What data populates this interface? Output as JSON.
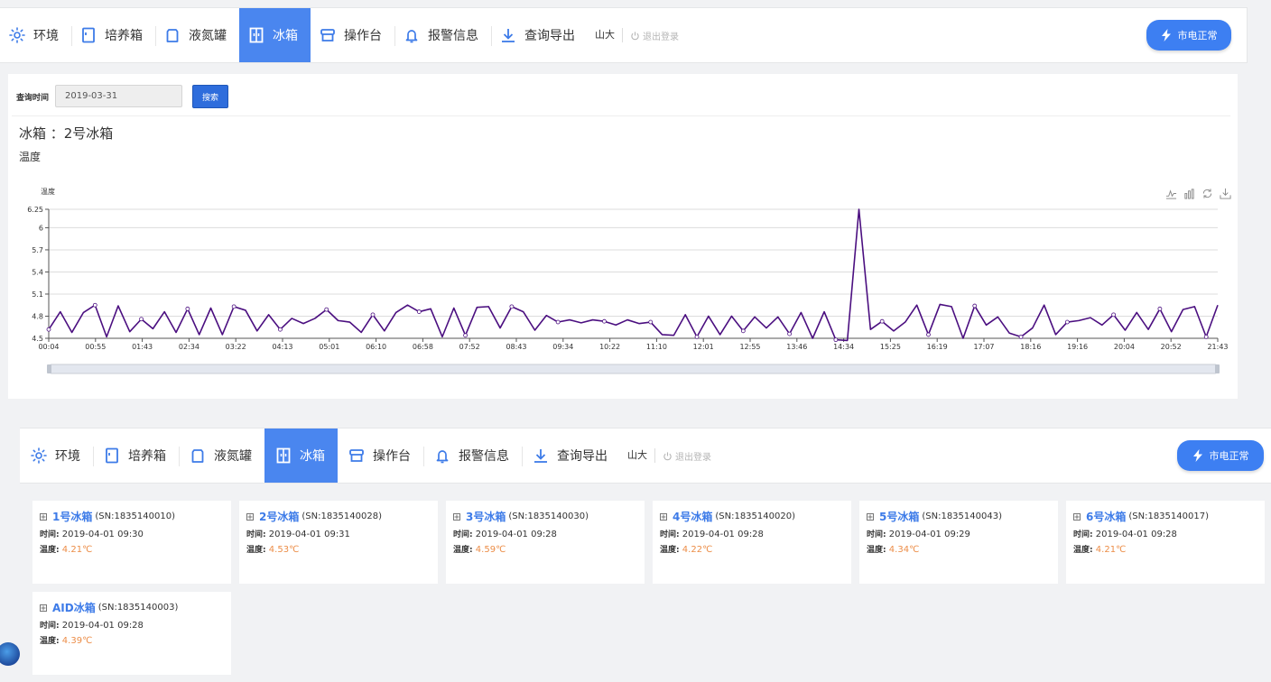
{
  "nav": {
    "items": [
      {
        "label": "环境",
        "icon": "environment-icon"
      },
      {
        "label": "培养箱",
        "icon": "incubator-icon"
      },
      {
        "label": "液氮罐",
        "icon": "nitrogen-tank-icon"
      },
      {
        "label": "冰箱",
        "icon": "fridge-icon",
        "active": true
      },
      {
        "label": "操作台",
        "icon": "workbench-icon"
      },
      {
        "label": "报警信息",
        "icon": "bell-icon"
      },
      {
        "label": "查询导出",
        "icon": "download-icon"
      }
    ],
    "user": "山大",
    "logout": "退出登录",
    "power_status": "市电正常"
  },
  "query": {
    "label": "查询时间",
    "date": "2019-03-31",
    "search": "搜索"
  },
  "device_title": "冰箱 ：2号冰箱",
  "sub_title": "温度",
  "chart_data": {
    "type": "line",
    "ylabel": "温度",
    "ylim": [
      4.5,
      6.25
    ],
    "yticks": [
      "6.25",
      "6",
      "5.7",
      "5.4",
      "5.1",
      "4.8",
      "4.5"
    ],
    "ytick_values": [
      6.25,
      6,
      5.7,
      5.4,
      5.1,
      4.8,
      4.5
    ],
    "categories": [
      "00:04",
      "00:55",
      "01:43",
      "02:34",
      "03:22",
      "04:13",
      "05:01",
      "06:10",
      "06:58",
      "07:52",
      "08:43",
      "09:34",
      "10:22",
      "11:10",
      "12:01",
      "12:55",
      "13:46",
      "14:34",
      "15:25",
      "16:19",
      "17:07",
      "18:16",
      "19:16",
      "20:04",
      "20:52",
      "21:43"
    ],
    "series": [
      {
        "color": "#4b0f80",
        "values": [
          4.62,
          4.86,
          4.58,
          4.85,
          4.95,
          4.52,
          4.94,
          4.59,
          4.76,
          4.63,
          4.86,
          4.58,
          4.9,
          4.55,
          4.91,
          4.55,
          4.93,
          4.88,
          4.6,
          4.82,
          4.62,
          4.77,
          4.7,
          4.77,
          4.89,
          4.74,
          4.72,
          4.58,
          4.82,
          4.6,
          4.85,
          4.95,
          4.86,
          4.9,
          4.52,
          4.91,
          4.54,
          4.92,
          4.93,
          4.64,
          4.93,
          4.86,
          4.61,
          4.81,
          4.72,
          4.75,
          4.71,
          4.75,
          4.73,
          4.68,
          4.75,
          4.7,
          4.72,
          4.55,
          4.54,
          4.82,
          4.52,
          4.8,
          4.55,
          4.8,
          4.6,
          4.79,
          4.64,
          4.79,
          4.56,
          4.85,
          4.5,
          4.86,
          4.48,
          4.47,
          6.25,
          4.62,
          4.73,
          4.6,
          4.72,
          4.95,
          4.55,
          4.96,
          4.93,
          4.5,
          4.94,
          4.68,
          4.79,
          4.57,
          4.52,
          4.64,
          4.95,
          4.55,
          4.72,
          4.74,
          4.78,
          4.68,
          4.82,
          4.61,
          4.85,
          4.62,
          4.9,
          4.59,
          4.89,
          4.93,
          4.52,
          4.95
        ]
      }
    ],
    "grid": true
  },
  "fridges": [
    {
      "name": "1号冰箱",
      "sn": "(SN:1835140010)",
      "time_label": "时间:",
      "time": "2019-04-01 09:30",
      "temp_label": "温度:",
      "temp": "4.21℃"
    },
    {
      "name": "2号冰箱",
      "sn": "(SN:1835140028)",
      "time_label": "时间:",
      "time": "2019-04-01 09:31",
      "temp_label": "温度:",
      "temp": "4.53℃"
    },
    {
      "name": "3号冰箱",
      "sn": "(SN:1835140030)",
      "time_label": "时间:",
      "time": "2019-04-01 09:28",
      "temp_label": "温度:",
      "temp": "4.59℃"
    },
    {
      "name": "4号冰箱",
      "sn": "(SN:1835140020)",
      "time_label": "时间:",
      "time": "2019-04-01 09:28",
      "temp_label": "温度:",
      "temp": "4.22℃"
    },
    {
      "name": "5号冰箱",
      "sn": "(SN:1835140043)",
      "time_label": "时间:",
      "time": "2019-04-01 09:29",
      "temp_label": "温度:",
      "temp": "4.34℃"
    },
    {
      "name": "6号冰箱",
      "sn": "(SN:1835140017)",
      "time_label": "时间:",
      "time": "2019-04-01 09:28",
      "temp_label": "温度:",
      "temp": "4.21℃"
    },
    {
      "name": "AID冰箱",
      "sn": "(SN:1835140003)",
      "time_label": "时间:",
      "time": "2019-04-01 09:28",
      "temp_label": "温度:",
      "temp": "4.39℃"
    }
  ],
  "colors": {
    "accent": "#4a86ef",
    "link": "#3d7be8",
    "temp": "#ec8d47",
    "line": "#4b0f80"
  }
}
